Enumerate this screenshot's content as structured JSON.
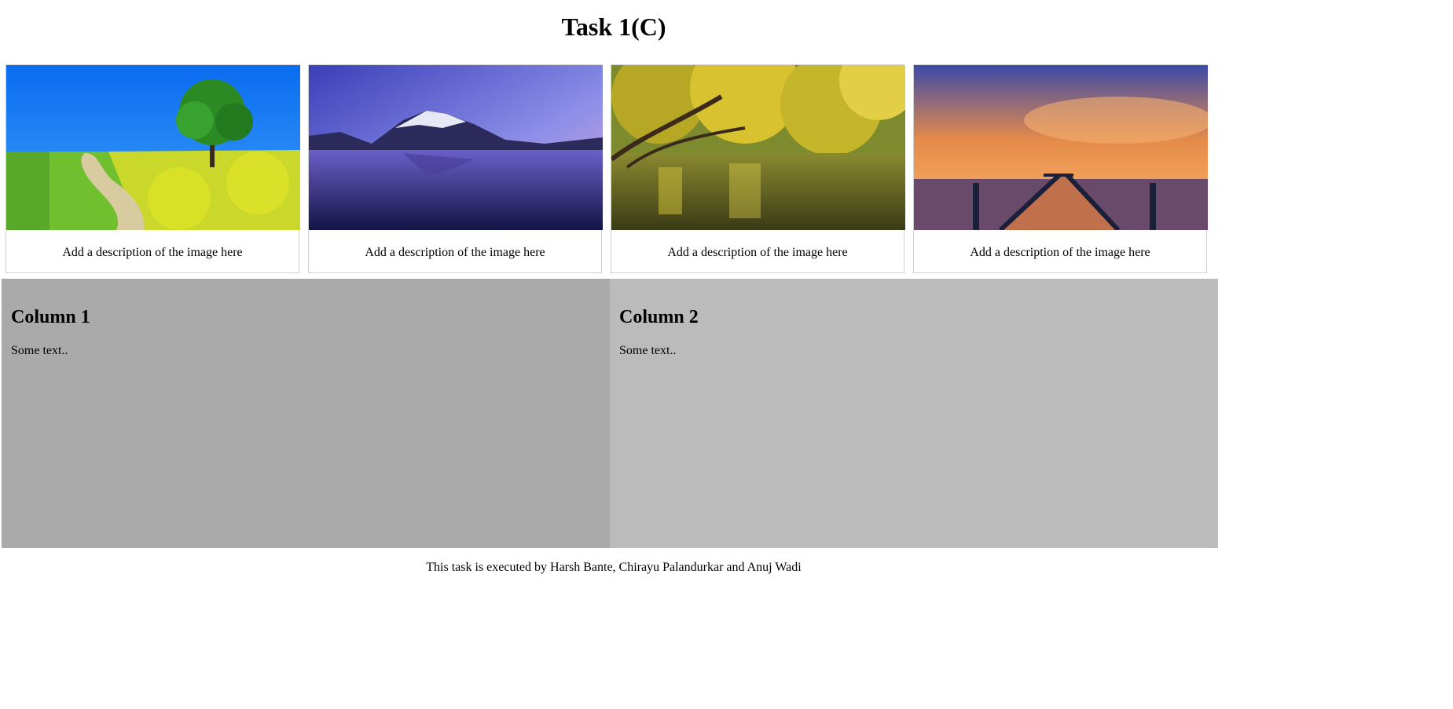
{
  "page": {
    "title": "Task 1(C)"
  },
  "gallery": [
    {
      "image": "landscape-tree-meadow-path",
      "description": "Add a description of the image here"
    },
    {
      "image": "snowy-mountain-lake",
      "description": "Add a description of the image here"
    },
    {
      "image": "autumn-tree-river",
      "description": "Add a description of the image here"
    },
    {
      "image": "sunset-pier-sea",
      "description": "Add a description of the image here"
    }
  ],
  "columns": [
    {
      "heading": "Column 1",
      "text": "Some text..",
      "color": "#aaaaaa"
    },
    {
      "heading": "Column 2",
      "text": "Some text..",
      "color": "#bbbbbb"
    }
  ],
  "footer": {
    "text": "This task is executed by Harsh Bante, Chirayu Palandurkar and Anuj Wadi"
  }
}
